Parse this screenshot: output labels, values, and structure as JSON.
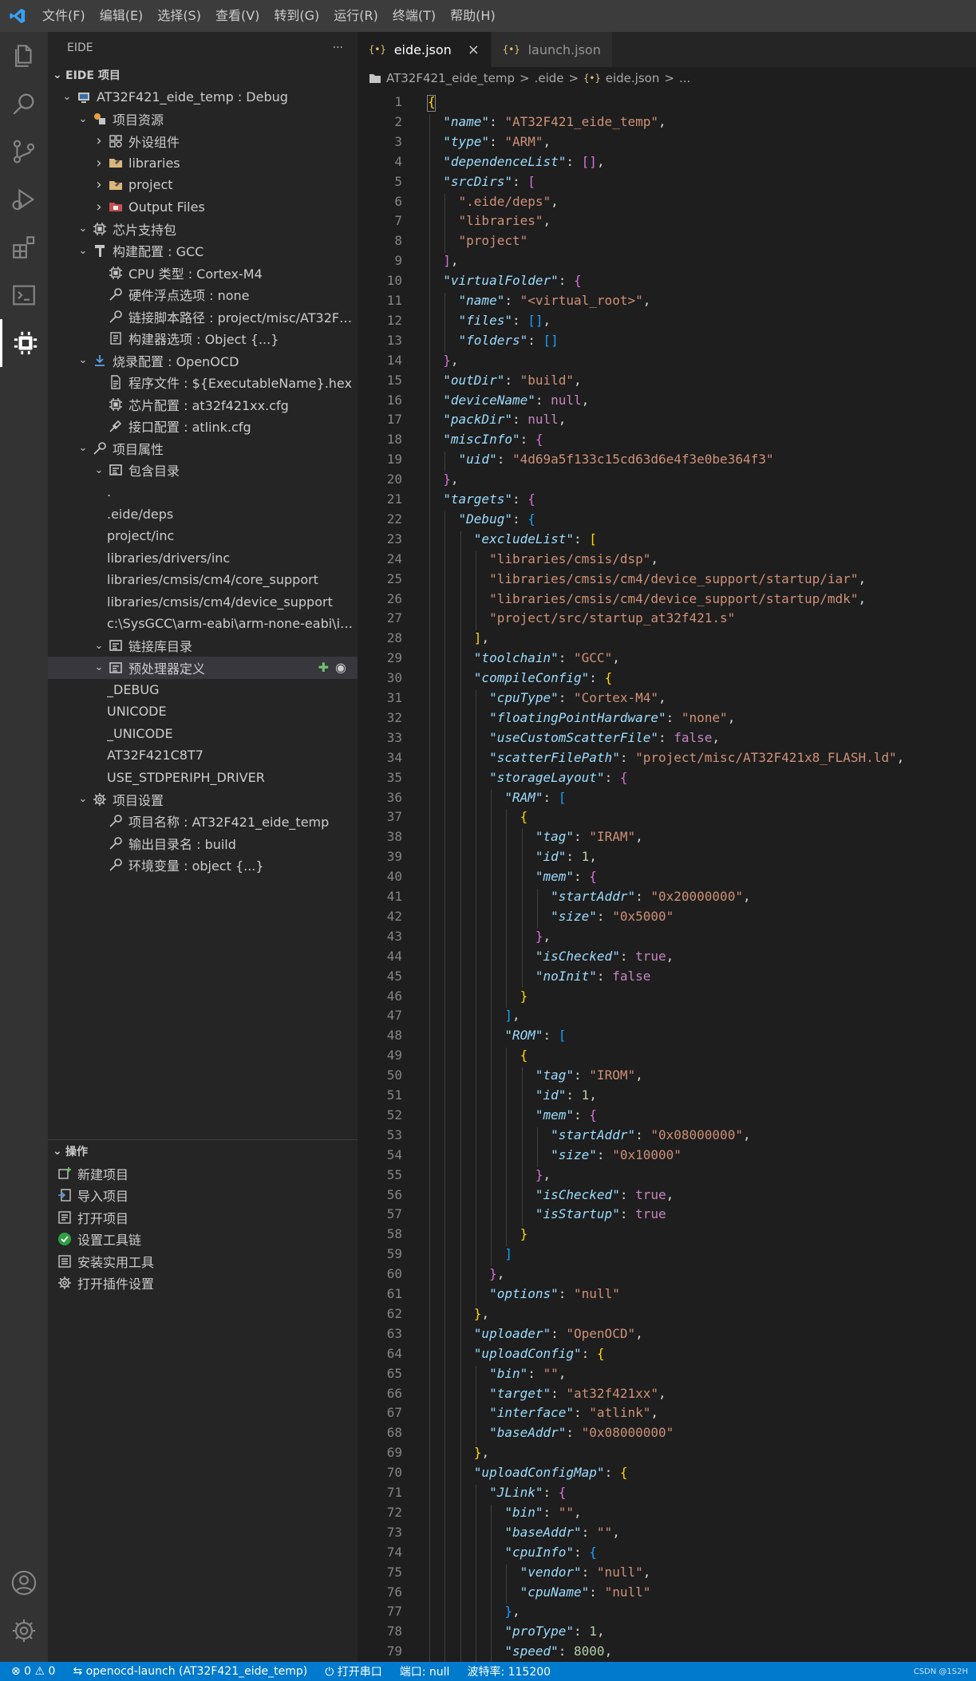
{
  "menu": [
    "文件(F)",
    "编辑(E)",
    "选择(S)",
    "查看(V)",
    "转到(G)",
    "运行(R)",
    "终端(T)",
    "帮助(H)"
  ],
  "sidebar": {
    "title": "EIDE",
    "more": "···",
    "section_title": "EIDE 项目",
    "tree": [
      {
        "label": "AT32F421_eide_temp : Debug",
        "icon": "project-icon"
      },
      {
        "label": "项目资源",
        "icon": "resources-icon"
      },
      {
        "label": "外设组件",
        "icon": "components-icon"
      },
      {
        "label": "libraries",
        "icon": "folder-icon"
      },
      {
        "label": "project",
        "icon": "folder-icon"
      },
      {
        "label": "Output Files",
        "icon": "output-folder-icon"
      },
      {
        "label": "芯片支持包",
        "icon": "chip-icon"
      },
      {
        "label": "构建配置 : GCC",
        "icon": "hammer-icon"
      },
      {
        "label": "CPU 类型 : Cortex-M4",
        "icon": "chip-icon"
      },
      {
        "label": "硬件浮点选项 : none",
        "icon": "wrench-icon"
      },
      {
        "label": "链接脚本路径 : project/misc/AT32F42...",
        "icon": "wrench-icon"
      },
      {
        "label": "构建器选项 : Object {...}",
        "icon": "document-icon"
      },
      {
        "label": "烧录配置 : OpenOCD",
        "icon": "download-icon"
      },
      {
        "label": "程序文件 : ${ExecutableName}.hex",
        "icon": "file-icon"
      },
      {
        "label": "芯片配置 : at32f421xx.cfg",
        "icon": "chip-icon"
      },
      {
        "label": "接口配置 : atlink.cfg",
        "icon": "plug-icon"
      },
      {
        "label": "项目属性",
        "icon": "wrench-icon"
      },
      {
        "label": "包含目录",
        "icon": "list-icon"
      },
      {
        "label": ".",
        "icon": ""
      },
      {
        "label": ".eide/deps",
        "icon": ""
      },
      {
        "label": "project/inc",
        "icon": ""
      },
      {
        "label": "libraries/drivers/inc",
        "icon": ""
      },
      {
        "label": "libraries/cmsis/cm4/core_support",
        "icon": ""
      },
      {
        "label": "libraries/cmsis/cm4/device_support",
        "icon": ""
      },
      {
        "label": "c:\\SysGCC\\arm-eabi\\arm-none-eabi\\incl...",
        "icon": ""
      },
      {
        "label": "链接库目录",
        "icon": "list-icon"
      },
      {
        "label": "预处理器定义",
        "icon": "list-icon"
      },
      {
        "label": "_DEBUG",
        "icon": ""
      },
      {
        "label": "UNICODE",
        "icon": ""
      },
      {
        "label": "_UNICODE",
        "icon": ""
      },
      {
        "label": "AT32F421C8T7",
        "icon": ""
      },
      {
        "label": "USE_STDPERIPH_DRIVER",
        "icon": ""
      },
      {
        "label": "项目设置",
        "icon": "gear-icon"
      },
      {
        "label": "项目名称 : AT32F421_eide_temp",
        "icon": "wrench-icon"
      },
      {
        "label": "输出目录名 : build",
        "icon": "wrench-icon"
      },
      {
        "label": "环境变量 : object {...}",
        "icon": "wrench-icon"
      }
    ],
    "ops_title": "操作",
    "ops": [
      {
        "label": "新建项目",
        "icon": "new-project-icon"
      },
      {
        "label": "导入项目",
        "icon": "import-icon"
      },
      {
        "label": "打开项目",
        "icon": "open-project-icon"
      },
      {
        "label": "设置工具链",
        "icon": "check-circle-icon"
      },
      {
        "label": "安装实用工具",
        "icon": "tools-icon"
      },
      {
        "label": "打开插件设置",
        "icon": "gear-icon"
      }
    ]
  },
  "editor": {
    "tabs": [
      {
        "label": "eide.json",
        "icon": "{•}",
        "active": true
      },
      {
        "label": "launch.json",
        "icon": "{•}",
        "active": false
      }
    ],
    "tab_close": "×",
    "breadcrumb": [
      "AT32F421_eide_temp",
      ">",
      ".eide",
      ">",
      "{•}",
      "eide.json",
      ">",
      "..."
    ]
  },
  "code_lines": [
    "{",
    "  \"name\": \"AT32F421_eide_temp\",",
    "  \"type\": \"ARM\",",
    "  \"dependenceList\": [],",
    "  \"srcDirs\": [",
    "    \".eide/deps\",",
    "    \"libraries\",",
    "    \"project\"",
    "  ],",
    "  \"virtualFolder\": {",
    "    \"name\": \"<virtual_root>\",",
    "    \"files\": [],",
    "    \"folders\": []",
    "  },",
    "  \"outDir\": \"build\",",
    "  \"deviceName\": null,",
    "  \"packDir\": null,",
    "  \"miscInfo\": {",
    "    \"uid\": \"4d69a5f133c15cd63d6e4f3e0be364f3\"",
    "  },",
    "  \"targets\": {",
    "    \"Debug\": {",
    "      \"excludeList\": [",
    "        \"libraries/cmsis/dsp\",",
    "        \"libraries/cmsis/cm4/device_support/startup/iar\",",
    "        \"libraries/cmsis/cm4/device_support/startup/mdk\",",
    "        \"project/src/startup_at32f421.s\"",
    "      ],",
    "      \"toolchain\": \"GCC\",",
    "      \"compileConfig\": {",
    "        \"cpuType\": \"Cortex-M4\",",
    "        \"floatingPointHardware\": \"none\",",
    "        \"useCustomScatterFile\": false,",
    "        \"scatterFilePath\": \"project/misc/AT32F421x8_FLASH.ld\",",
    "        \"storageLayout\": {",
    "          \"RAM\": [",
    "            {",
    "              \"tag\": \"IRAM\",",
    "              \"id\": 1,",
    "              \"mem\": {",
    "                \"startAddr\": \"0x20000000\",",
    "                \"size\": \"0x5000\"",
    "              },",
    "              \"isChecked\": true,",
    "              \"noInit\": false",
    "            }",
    "          ],",
    "          \"ROM\": [",
    "            {",
    "              \"tag\": \"IROM\",",
    "              \"id\": 1,",
    "              \"mem\": {",
    "                \"startAddr\": \"0x08000000\",",
    "                \"size\": \"0x10000\"",
    "              },",
    "              \"isChecked\": true,",
    "              \"isStartup\": true",
    "            }",
    "          ]",
    "        },",
    "        \"options\": \"null\"",
    "      },",
    "      \"uploader\": \"OpenOCD\",",
    "      \"uploadConfig\": {",
    "        \"bin\": \"\",",
    "        \"target\": \"at32f421xx\",",
    "        \"interface\": \"atlink\",",
    "        \"baseAddr\": \"0x08000000\"",
    "      },",
    "      \"uploadConfigMap\": {",
    "        \"JLink\": {",
    "          \"bin\": \"\",",
    "          \"baseAddr\": \"\",",
    "          \"cpuInfo\": {",
    "            \"vendor\": \"null\",",
    "            \"cpuName\": \"null\"",
    "          },",
    "          \"proType\": 1,",
    "          \"speed\": 8000,"
  ],
  "statusbar": {
    "errors": "⊗ 0",
    "warnings": "⚠ 0",
    "launch": "openocd-launch (AT32F421_eide_temp)",
    "serial": "打开串口",
    "port": "端口: null",
    "baud": "波特率: 115200",
    "credit": "CSDN @1S2H"
  }
}
